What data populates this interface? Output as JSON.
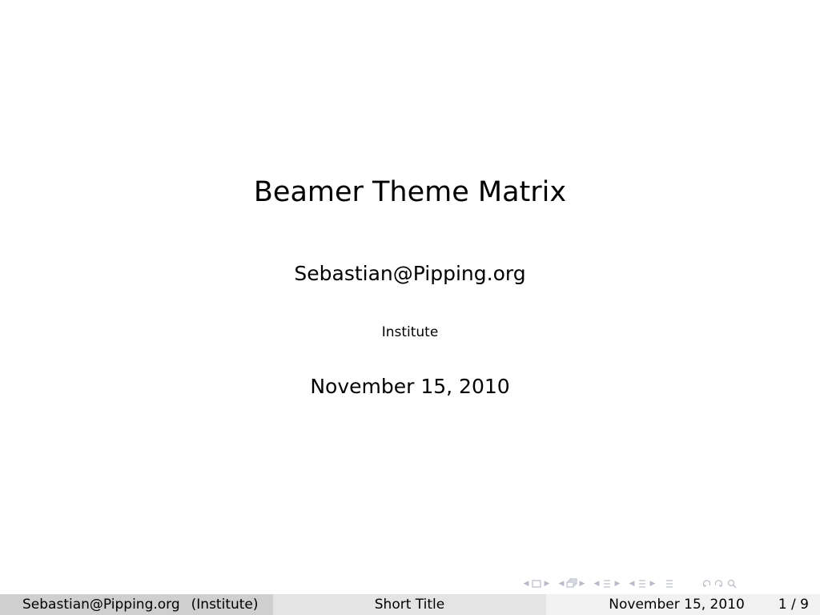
{
  "slide": {
    "title": "Beamer Theme Matrix",
    "author": "Sebastian@Pipping.org",
    "institute": "Institute",
    "date": "November 15, 2010"
  },
  "footer": {
    "left_author": "Sebastian@Pipping.org",
    "left_institute": "(Institute)",
    "short_title": "Short Title",
    "date": "November 15, 2010",
    "page": "1 / 9"
  },
  "navigation": {
    "icons": [
      "frame-nav-icon",
      "subsection-nav-icon",
      "section-nav-icon",
      "section-list-nav-icon",
      "document-nav-icon",
      "back-icon",
      "forward-icon",
      "search-icon"
    ],
    "icon_color": "#b8bcc8"
  },
  "colors": {
    "footer_left_bg": "#cfcfcf",
    "footer_mid_bg": "#e4e4e4",
    "footer_right_bg": "#f1f1f1"
  }
}
